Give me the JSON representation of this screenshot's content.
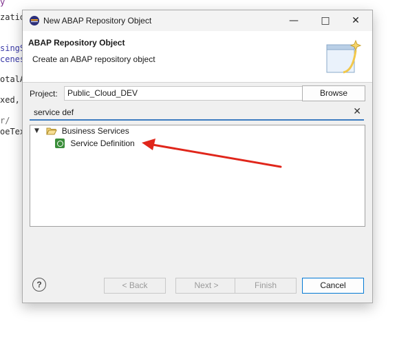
{
  "background_code": [
    {
      "text": "y"
    },
    {
      "text": "zatio"
    },
    {
      "text": "singS"
    },
    {
      "text": "cenes"
    },
    {
      "text": "otalA"
    },
    {
      "text": "xed,"
    },
    {
      "text": "r/"
    },
    {
      "text": "oeTex"
    }
  ],
  "dialog": {
    "title": "New ABAP Repository Object",
    "banner_title": "ABAP Repository Object",
    "banner_subtitle": "Create an ABAP repository object",
    "project_label": "Project:",
    "project_value": "Public_Cloud_DEV",
    "browse_label": "Browse",
    "search_value": "service def",
    "tree": {
      "category": "Business Services",
      "item": "Service Definition"
    },
    "help_symbol": "?",
    "buttons": {
      "back": "< Back",
      "next": "Next >",
      "finish": "Finish",
      "cancel": "Cancel"
    }
  },
  "colors": {
    "arrow": "#e0261b",
    "accent": "#0078d4"
  }
}
